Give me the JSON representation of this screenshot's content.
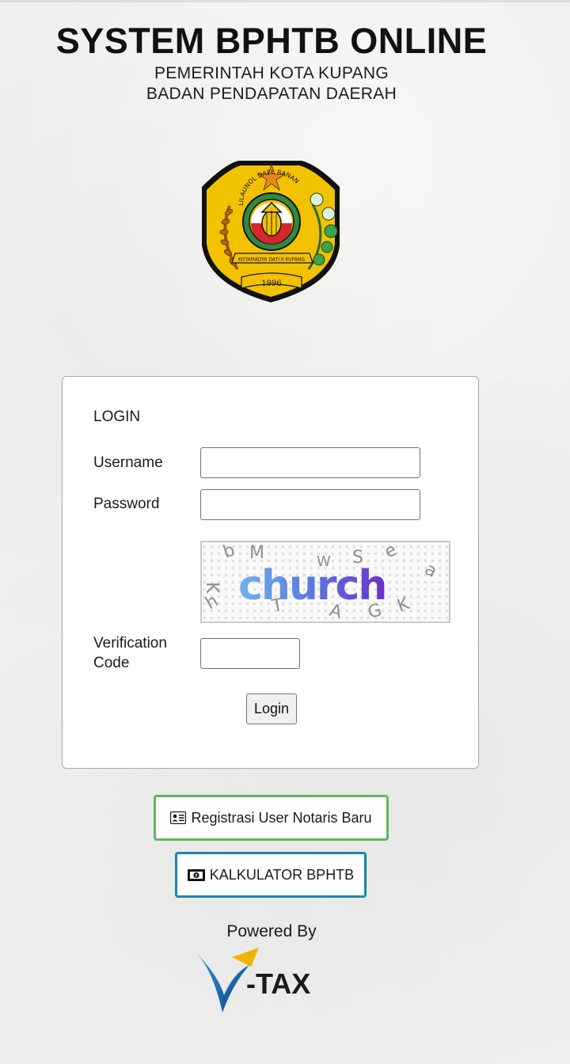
{
  "header": {
    "title": "SYSTEM BPHTB ONLINE",
    "subtitle_line1": "PEMERINTAH KOTA KUPANG",
    "subtitle_line2": "BADAN PENDAPATAN DAERAH"
  },
  "emblem": {
    "icon": "kupang-city-emblem",
    "motto": "LILAUNOL DAEL BANAN",
    "inscription": "KOTAMADYA DATI II KUPANG",
    "year": "1996"
  },
  "login": {
    "title": "LOGIN",
    "username_label": "Username",
    "username_value": "",
    "password_label": "Password",
    "password_value": "",
    "captcha_word": "church",
    "verification_label_line1": "Verification",
    "verification_label_line2": "Code",
    "verification_value": "",
    "submit_label": "Login"
  },
  "actions": {
    "register_label": "Registrasi User Notaris Baru",
    "register_icon": "id-card-icon",
    "calculator_label": "KALKULATOR BPHTB",
    "calculator_icon": "money-bill-icon"
  },
  "footer": {
    "powered_by": "Powered By",
    "brand": "-TAX"
  },
  "colors": {
    "register_border": "#5cb85c",
    "calculator_border": "#1b87ad",
    "emblem_gold": "#f2c200",
    "emblem_green": "#2e8b3e",
    "emblem_red": "#d4262b",
    "captcha_text_start": "#6fb4e8",
    "captcha_text_end": "#6b2fc9",
    "vtax_blue": "#1664b4",
    "vtax_gold": "#f0b400"
  }
}
